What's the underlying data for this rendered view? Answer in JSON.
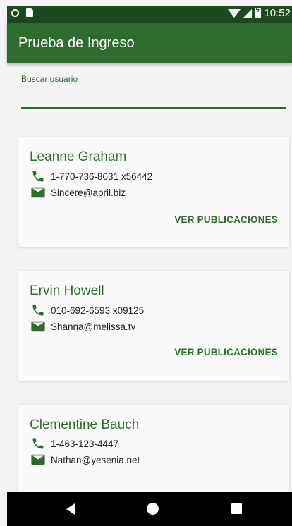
{
  "status_bar": {
    "time": "10:52"
  },
  "app_bar": {
    "title": "Prueba de Ingreso"
  },
  "search": {
    "label": "Buscar usuario",
    "value": ""
  },
  "users": [
    {
      "name": "Leanne Graham",
      "phone": "1-770-736-8031 x56442",
      "email": "Sincere@april.biz",
      "action": "VER PUBLICACIONES"
    },
    {
      "name": "Ervin Howell",
      "phone": "010-692-6593 x09125",
      "email": "Shanna@melissa.tv",
      "action": "VER PUBLICACIONES"
    },
    {
      "name": "Clementine Bauch",
      "phone": "1-463-123-4447",
      "email": "Nathan@yesenia.net"
    }
  ],
  "colors": {
    "primary": "#2e6b2f",
    "primary_dark": "#1b4a1e",
    "background": "#f3f3f3",
    "card": "#fafafa"
  },
  "icons": {
    "phone": "phone-icon",
    "email": "mail-icon",
    "back": "back-icon",
    "home": "home-icon",
    "recent": "recent-apps-icon"
  }
}
